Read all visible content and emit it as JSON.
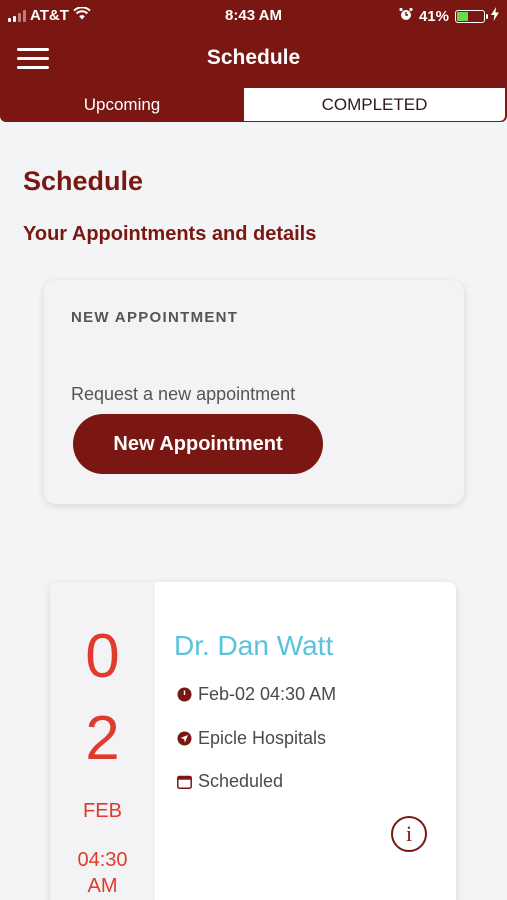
{
  "status_bar": {
    "carrier": "AT&T",
    "time": "8:43 AM",
    "battery": "41%",
    "battery_level": 0.41,
    "icons": [
      "signal-icon",
      "wifi-icon",
      "alarm-icon",
      "battery-icon",
      "charging-icon"
    ]
  },
  "header": {
    "title": "Schedule",
    "menu_icon": "hamburger-menu-icon"
  },
  "tabs": [
    {
      "label": "Upcoming",
      "active": false
    },
    {
      "label": "COMPLETED",
      "active": true
    }
  ],
  "page": {
    "heading": "Schedule",
    "subheading": "Your Appointments and details"
  },
  "new_appointment": {
    "title": "NEW APPOINTMENT",
    "text": "Request a new appointment",
    "button_label": "New Appointment"
  },
  "appointment": {
    "day_digit_1": "0",
    "day_digit_2": "2",
    "month": "FEB",
    "time_line_1": "04:30",
    "time_line_2": "AM",
    "doctor": "Dr. Dan Watt",
    "datetime": "Feb-02 04:30 AM",
    "location": "Epicle Hospitals",
    "status": "Scheduled",
    "info_icon": "info-icon"
  },
  "colors": {
    "primary": "#7a1712",
    "accent_red": "#e03a2c",
    "doctor_blue": "#5ac3dc",
    "background": "#f3f4f6"
  }
}
